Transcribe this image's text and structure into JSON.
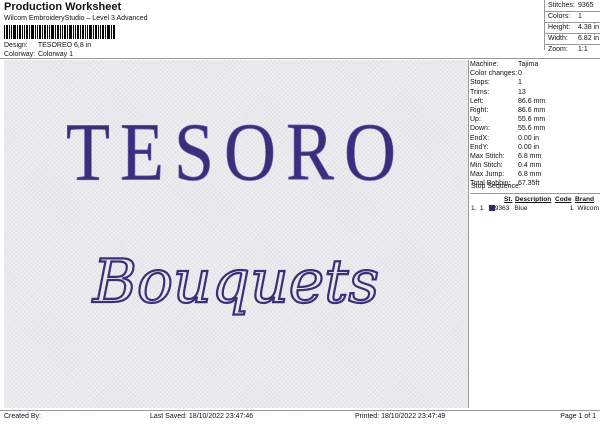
{
  "header": {
    "title": "Production Worksheet",
    "subtitle": "Wilcom EmbroideryStudio – Level 3 Advanced",
    "design_label": "Design:",
    "design_value": "TESOREO 6,8 in",
    "colorway_label": "Colorway:",
    "colorway_value": "Colorway 1"
  },
  "summary": {
    "stitches_label": "Stitches:",
    "stitches_value": "9365",
    "colors_label": "Colors:",
    "colors_value": "1",
    "height_label": "Height:",
    "height_value": "4.38 in",
    "width_label": "Width:",
    "width_value": "6.82 in",
    "zoom_label": "Zoom:",
    "zoom_value": "1:1"
  },
  "design": {
    "line1": "TESORO",
    "line2": "Bouquets",
    "thread_color": "#3c2f7a",
    "thread_highlight": "#6757b8"
  },
  "machine_info": [
    {
      "label": "Machine:",
      "value": "Tajima"
    },
    {
      "label": "Color changes:",
      "value": "0"
    },
    {
      "label": "Stops:",
      "value": "1"
    },
    {
      "label": "Trims:",
      "value": "13"
    },
    {
      "label": "Left:",
      "value": "86.6 mm"
    },
    {
      "label": "Right:",
      "value": "86.6 mm"
    },
    {
      "label": "Up:",
      "value": "55.6 mm"
    },
    {
      "label": "Down:",
      "value": "55.6 mm"
    },
    {
      "label": "EndX:",
      "value": "0.00 in"
    },
    {
      "label": "EndY:",
      "value": "0.00 in"
    },
    {
      "label": "Max Stitch:",
      "value": "6.8 mm"
    },
    {
      "label": "Min Stitch:",
      "value": "0.4 mm"
    },
    {
      "label": "Max Jump:",
      "value": "6.8 mm"
    },
    {
      "label": "Total Bobbin:",
      "value": "67.35ft"
    }
  ],
  "stop_sequence": {
    "title": "Stop Sequence:",
    "columns": [
      "St.",
      "Description",
      "Code",
      "Brand"
    ],
    "rows": [
      {
        "index": "1.",
        "num": "1",
        "stitches": "9363",
        "description": "Blue",
        "code": "1",
        "brand": "Wilcom",
        "color": "#2b2a6b"
      }
    ]
  },
  "footer": {
    "created_by": "Created By:",
    "last_saved": "Last Saved: 18/10/2022 23:47:46",
    "printed": "Printed: 18/10/2022 23:47:49",
    "page": "Page 1 of 1"
  }
}
